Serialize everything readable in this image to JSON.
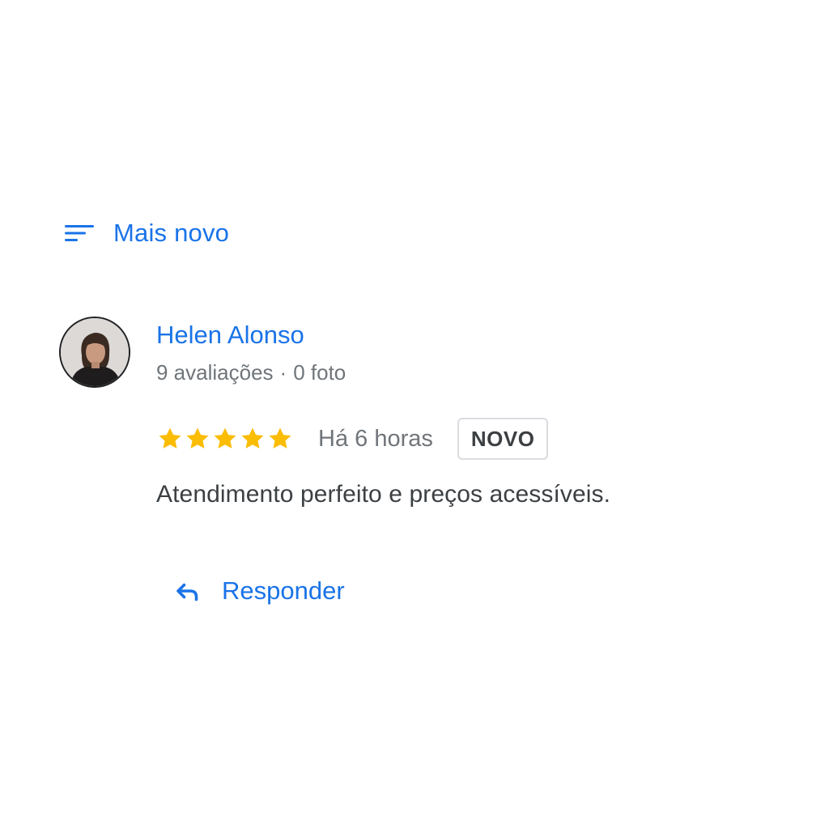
{
  "sort": {
    "label": "Mais novo",
    "icon": "sort-icon"
  },
  "review": {
    "author": {
      "name": "Helen Alonso",
      "review_count": "9 avaliações",
      "separator": "·",
      "photo_count": "0 foto"
    },
    "rating": 5,
    "rating_max": 5,
    "time_ago": "Há 6 horas",
    "badge": "NOVO",
    "text": "Atendimento perfeito e preços acessíveis.",
    "reply": {
      "label": "Responder",
      "icon": "reply-icon"
    }
  },
  "colors": {
    "link": "#1a73e8",
    "star": "#fbbc04",
    "secondary_text": "#70757a",
    "body_text": "#3c4043",
    "badge_border": "#dadce0"
  }
}
